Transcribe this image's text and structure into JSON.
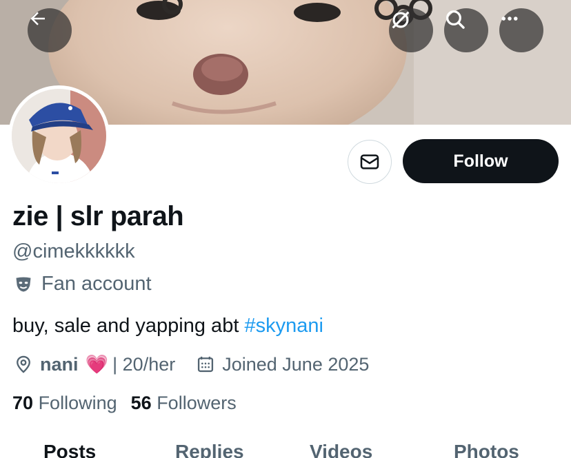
{
  "header": {
    "back_icon": "arrow-left-icon",
    "translate_icon": "grok-slash-icon",
    "search_icon": "search-icon",
    "more_icon": "more-horizontal-icon"
  },
  "profile": {
    "display_name": "zie | slr parah",
    "handle": "@cimekkkkkk",
    "category_icon": "theater-masks-icon",
    "category": "Fan account",
    "bio_text": "buy, sale and yapping abt ",
    "bio_hashtag": "#skynani",
    "location": "nani",
    "location_emoji": "💗",
    "location_extra": "| 20/her",
    "joined": "Joined June 2025",
    "following_count": "70",
    "following_label": "Following",
    "followers_count": "56",
    "followers_label": "Followers"
  },
  "actions": {
    "message_icon": "mail-icon",
    "follow_label": "Follow"
  },
  "tabs": [
    "Posts",
    "Replies",
    "Videos",
    "Photos"
  ],
  "colors": {
    "text_primary": "#0f1419",
    "text_secondary": "#536471",
    "accent": "#1d9bf0",
    "follow_bg": "#0f1419"
  }
}
